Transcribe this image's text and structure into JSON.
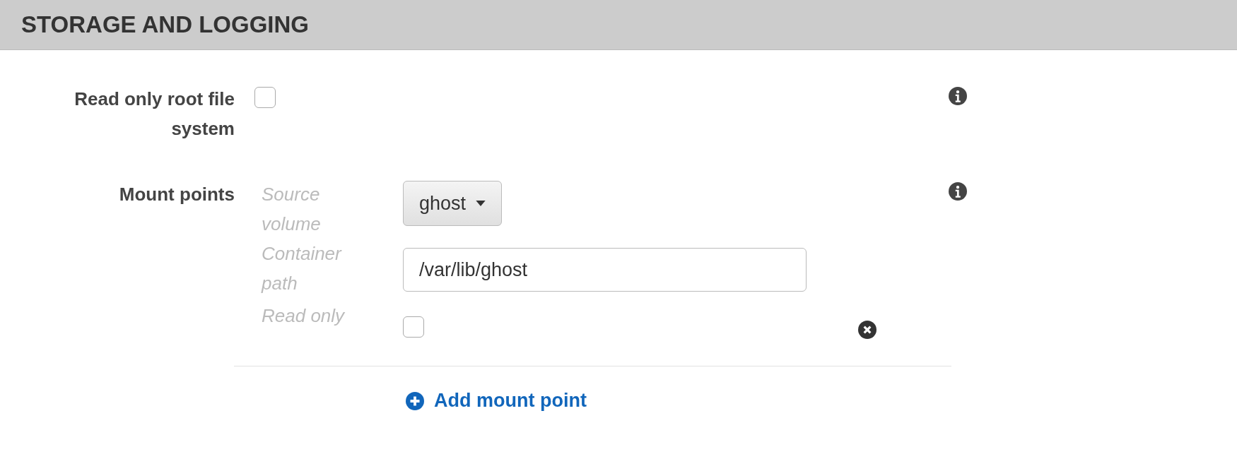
{
  "section": {
    "title": "STORAGE AND LOGGING"
  },
  "read_only_root": {
    "label": "Read only root file system",
    "checked": false
  },
  "mount_points": {
    "label": "Mount points",
    "items": [
      {
        "source_label": "Source volume",
        "source_value": "ghost",
        "path_label": "Container path",
        "path_value": "/var/lib/ghost",
        "read_only_label": "Read only",
        "read_only": false
      }
    ],
    "add_label": "Add mount point"
  }
}
